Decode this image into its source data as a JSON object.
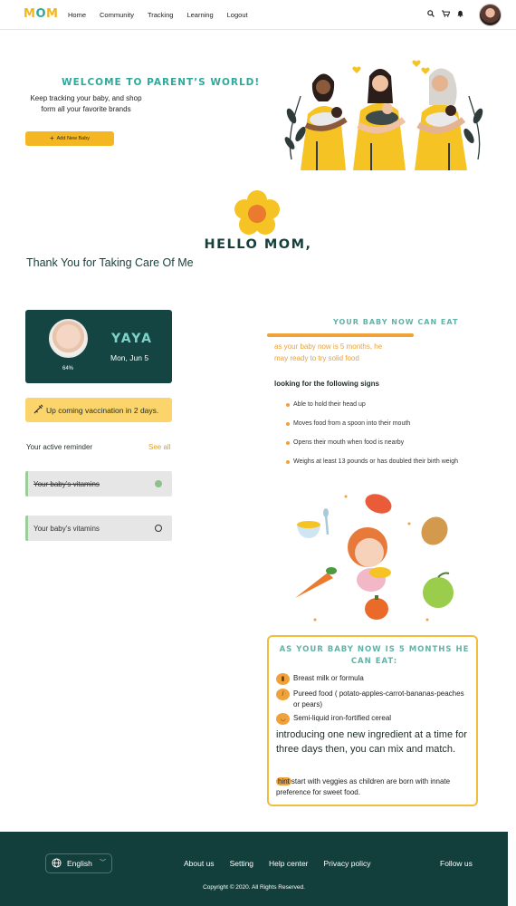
{
  "header": {
    "logo": {
      "part1": "M",
      "part2": "O",
      "part3": "M"
    },
    "nav": [
      "Home",
      "Community",
      "Tracking",
      "Learning",
      "Logout"
    ],
    "icons": [
      "search-icon",
      "cart-icon",
      "bell-icon"
    ]
  },
  "hero": {
    "welcome": "WELCOME TO PARENT’S WORLD!",
    "subtitle": "Keep tracking your baby, and shop form all your favorite brands",
    "add_baby": "Add New Baby"
  },
  "hello": {
    "title": "HELLO MOM,",
    "subtitle": "Thank You for Taking Care Of Me"
  },
  "baby_card": {
    "name": "YAYA",
    "date": "Mon, Jun 5",
    "progress_label": "64%",
    "progress": 0.64
  },
  "vaccination": {
    "text": "Up coming vaccination in 2 days."
  },
  "reminders": {
    "title": "Your active reminder",
    "see_all": "See all",
    "items": [
      {
        "label": "Your baby’s vitamins",
        "done": true
      },
      {
        "label": "Your baby’s vitamins",
        "done": false
      }
    ]
  },
  "can_eat": {
    "title": "YOUR BABY NOW CAN EAT",
    "ready_text": "as your baby now is 5 months, he may ready to try solid food",
    "signs_title": "looking for the following signs",
    "signs": [
      "Able to hold their head up",
      "Moves food from a spoon into their mouth",
      "Opens their mouth when food is nearby",
      "Weighs at least 13 pounds or has doubled their birth weigh"
    ]
  },
  "months_box": {
    "title": "AS YOUR BABY NOW IS 5 MONTHS HE CAN EAT:",
    "items": [
      "Breast milk or formula",
      "Pureed food ( potato-apples-carrot-bananas-peaches or pears)",
      "Semi-liquid iron-fortified cereal"
    ],
    "intro": "introducing one new ingredient at a time for three days then, you can mix and match.",
    "hint_tag": "hint",
    "hint_text": "start with veggies as children are born with innate preference for sweet food."
  },
  "footer": {
    "language": "English",
    "links": [
      "About us",
      "Setting",
      "Help center",
      "Privacy policy"
    ],
    "follow": "Follow us",
    "copyright": "Copyright © 2020. All Rights Reserved."
  },
  "colors": {
    "brand_teal": "#2fa99b",
    "brand_yellow": "#f5b623",
    "dark_green": "#154542",
    "accent_orange": "#f0a23a"
  }
}
